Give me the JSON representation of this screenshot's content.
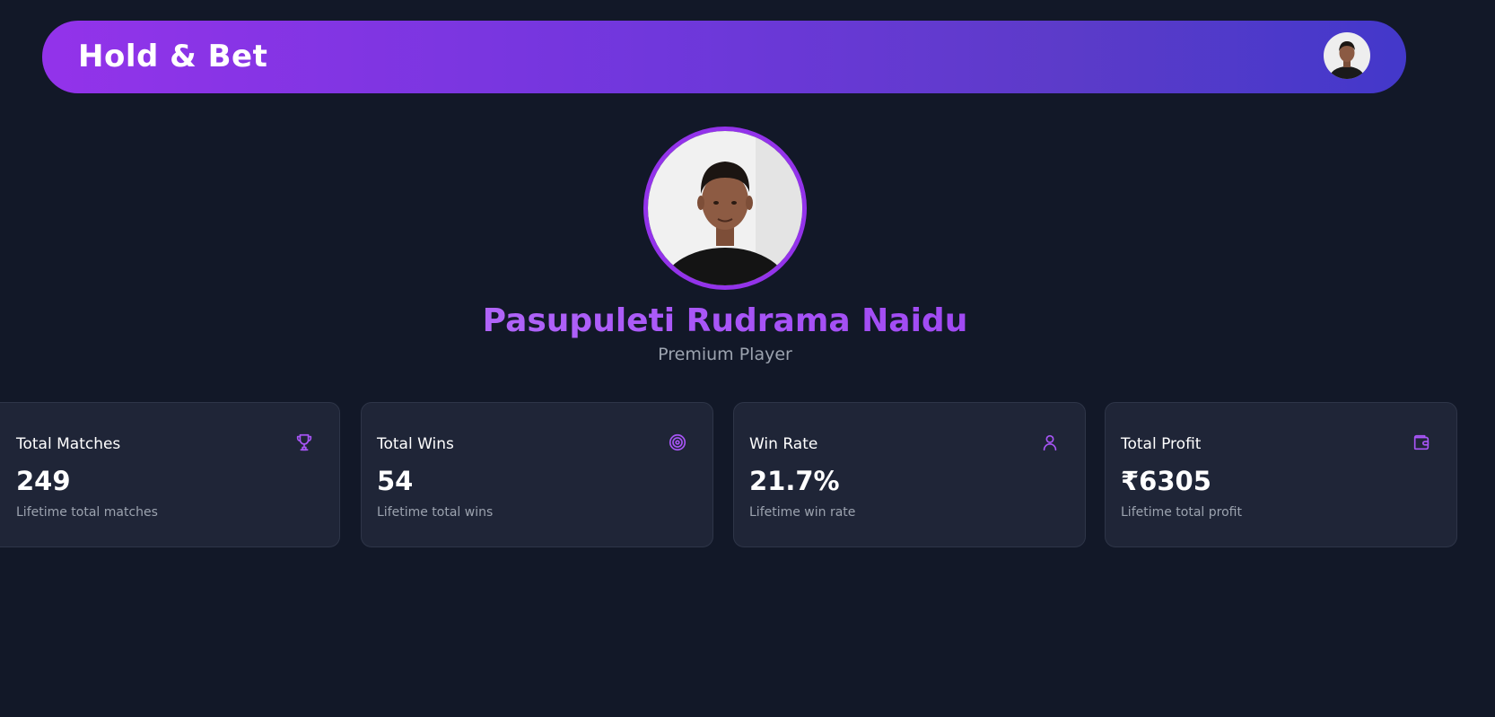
{
  "header": {
    "brand": "Hold & Bet",
    "avatar_icon": "user-avatar"
  },
  "profile": {
    "name": "Pasupuleti Rudrama Naidu",
    "subtitle": "Premium Player",
    "avatar_icon": "profile-photo"
  },
  "stats": [
    {
      "title": "Total Matches",
      "value": "249",
      "description": "Lifetime total matches",
      "icon": "trophy-icon"
    },
    {
      "title": "Total Wins",
      "value": "54",
      "description": "Lifetime total wins",
      "icon": "target-icon"
    },
    {
      "title": "Win Rate",
      "value": "21.7%",
      "description": "Lifetime win rate",
      "icon": "user-icon"
    },
    {
      "title": "Total Profit",
      "value": "₹6305",
      "description": "Lifetime total profit",
      "icon": "wallet-icon"
    }
  ],
  "colors": {
    "background": "#121828",
    "accent": "#9333ea",
    "accent_end": "#4338ca",
    "card": "#1f2537",
    "icon": "#a855f7"
  }
}
